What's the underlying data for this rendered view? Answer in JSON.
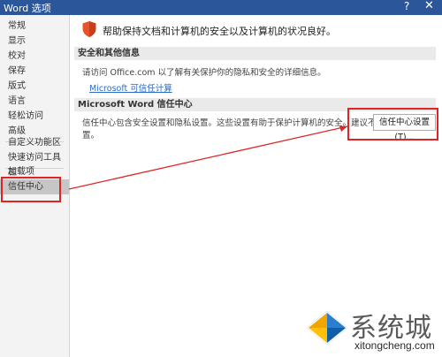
{
  "window": {
    "title": "Word 选项",
    "help_glyph": "?",
    "close_glyph": "✕"
  },
  "sidebar": {
    "items": [
      {
        "label": "常规"
      },
      {
        "label": "显示"
      },
      {
        "label": "校对"
      },
      {
        "label": "保存"
      },
      {
        "label": "版式"
      },
      {
        "label": "语言"
      },
      {
        "label": "轻松访问"
      },
      {
        "label": "高级"
      },
      {
        "label": "自定义功能区"
      },
      {
        "label": "快速访问工具栏"
      },
      {
        "label": "加载项"
      },
      {
        "label": "信任中心",
        "selected": true
      }
    ]
  },
  "main": {
    "intro": "帮助保持文档和计算机的安全以及计算机的状况良好。",
    "privacy": {
      "header": "安全和其他信息",
      "text": "请访问 Office.com 以了解有关保护你的隐私和安全的详细信息。",
      "link": "Microsoft 可信任计算"
    },
    "trust_center": {
      "header": "Microsoft Word 信任中心",
      "text": "信任中心包含安全设置和隐私设置。这些设置有助于保护计算机的安全。建议不要更改这些设置。",
      "button": "信任中心设置(T)..."
    }
  },
  "watermark": {
    "text": "系统城",
    "url": "xitongcheng.com"
  },
  "colors": {
    "titlebar": "#2b579a",
    "annotation": "#e02424",
    "link": "#2e6bc6",
    "shield": "#e8532c"
  },
  "icons": {
    "shield": "shield-icon",
    "watermark_logo": "logo-icon"
  }
}
